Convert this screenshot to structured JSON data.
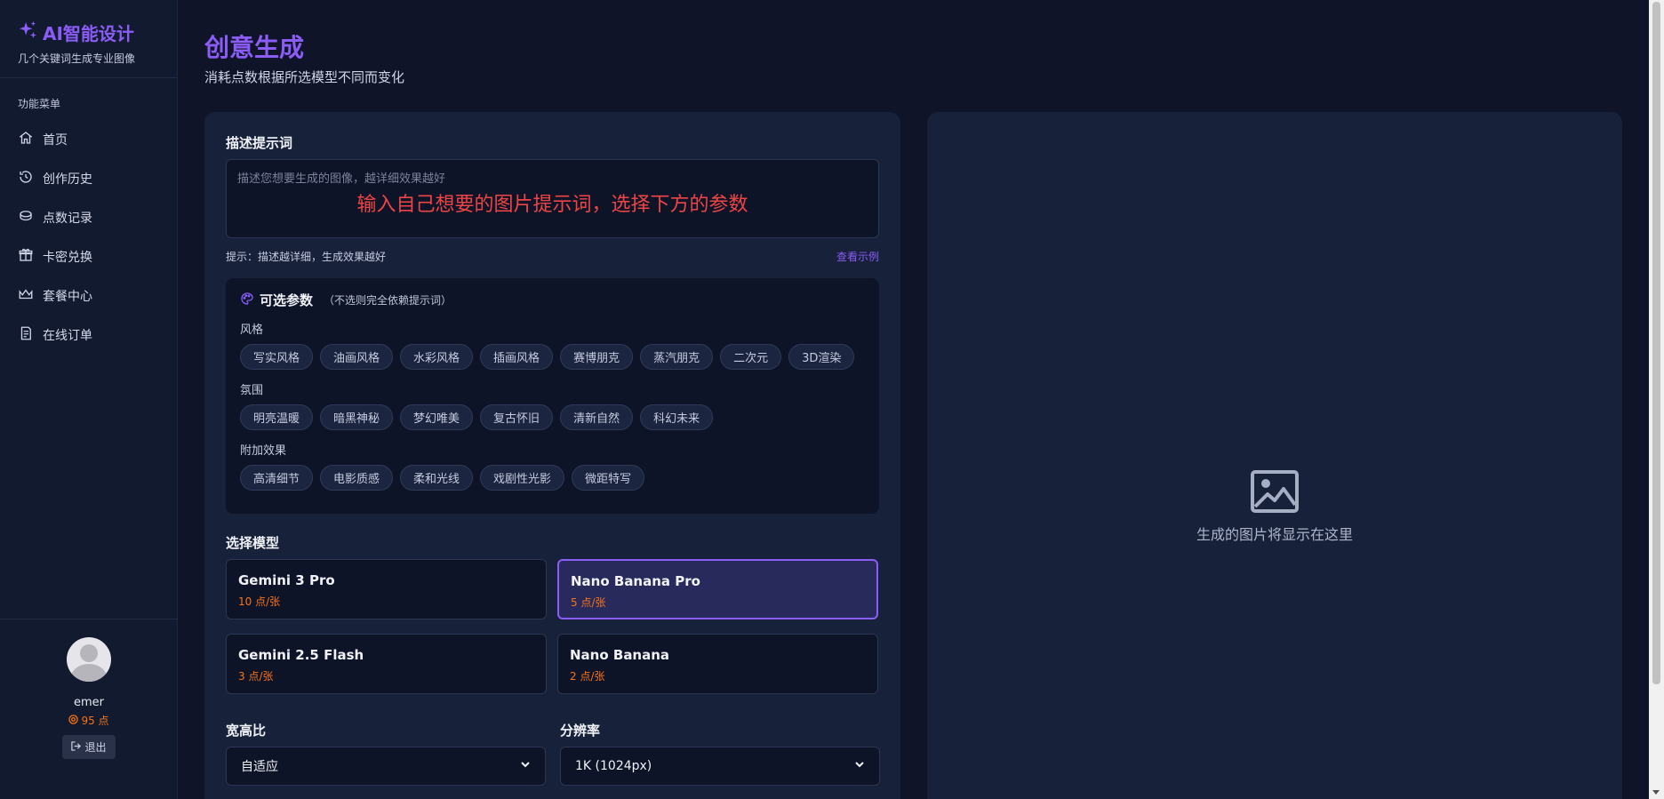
{
  "app": {
    "brand_title": "AI智能设计",
    "brand_subtitle": "几个关键词生成专业图像",
    "accent_color": "#8b5cf6"
  },
  "sidebar": {
    "menu_label": "功能菜单",
    "items": [
      {
        "label": "首页",
        "icon": "home-icon"
      },
      {
        "label": "创作历史",
        "icon": "history-icon"
      },
      {
        "label": "点数记录",
        "icon": "coins-icon"
      },
      {
        "label": "卡密兑换",
        "icon": "gift-icon"
      },
      {
        "label": "套餐中心",
        "icon": "crown-icon"
      },
      {
        "label": "在线订单",
        "icon": "order-icon"
      }
    ],
    "user": {
      "name": "emer",
      "points": "95 点",
      "logout_label": "退出"
    }
  },
  "header": {
    "title": "创意生成",
    "subtitle": "消耗点数根据所选模型不同而变化"
  },
  "form": {
    "prompt_label": "描述提示词",
    "prompt_placeholder": "描述您想要生成的图像，越详细效果越好",
    "prompt_overlay_hint": "输入自己想要的图片提示词，选择下方的参数",
    "hint_text": "提示：描述越详细，生成效果越好",
    "hint_link": "查看示例",
    "params": {
      "title": "可选参数",
      "note": "（不选则完全依赖提示词）",
      "groups": [
        {
          "label": "风格",
          "options": [
            "写实风格",
            "油画风格",
            "水彩风格",
            "插画风格",
            "赛博朋克",
            "蒸汽朋克",
            "二次元",
            "3D渲染"
          ]
        },
        {
          "label": "氛围",
          "options": [
            "明亮温暖",
            "暗黑神秘",
            "梦幻唯美",
            "复古怀旧",
            "清新自然",
            "科幻未来"
          ]
        },
        {
          "label": "附加效果",
          "options": [
            "高清细节",
            "电影质感",
            "柔和光线",
            "戏剧性光影",
            "微距特写"
          ]
        }
      ]
    },
    "model_label": "选择模型",
    "models": [
      {
        "name": "Gemini 3 Pro",
        "price": "10 点/张",
        "selected": false
      },
      {
        "name": "Nano Banana Pro",
        "price": "5 点/张",
        "selected": true
      },
      {
        "name": "Gemini 2.5 Flash",
        "price": "3 点/张",
        "selected": false
      },
      {
        "name": "Nano Banana",
        "price": "2 点/张",
        "selected": false
      }
    ],
    "aspect_label": "宽高比",
    "aspect_value": "自适应",
    "resolution_label": "分辨率",
    "resolution_value": "1K (1024px)"
  },
  "preview": {
    "placeholder_text": "生成的图片将显示在这里",
    "icon": "image-icon"
  }
}
